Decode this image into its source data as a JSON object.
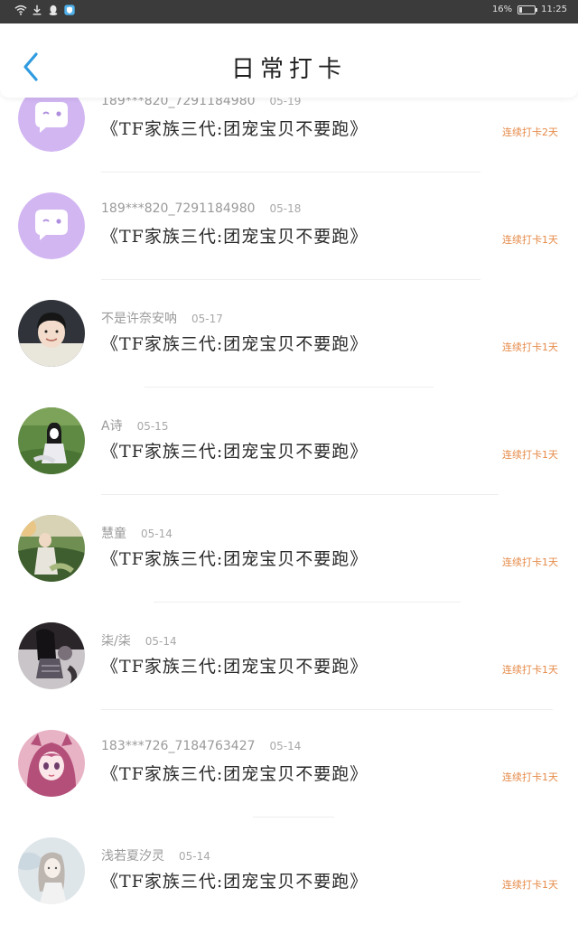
{
  "status_bar": {
    "battery_text": "16%",
    "battery_level_percent": 16,
    "time": "11:25"
  },
  "header": {
    "back_icon": "chevron-left-icon",
    "title": "日常打卡"
  },
  "colors": {
    "accent_blue": "#2f9be0",
    "streak_orange": "#e58a48",
    "chat_avatar_purple": "#d2b6f2"
  },
  "checkins": [
    {
      "user": "189***820_7291184980",
      "date": "05-19",
      "title": "《TF家族三代:团宠宝贝不要跑》",
      "streak": "连续打卡2天",
      "avatar": "chat-bubble-avatar"
    },
    {
      "user": "189***820_7291184980",
      "date": "05-18",
      "title": "《TF家族三代:团宠宝贝不要跑》",
      "streak": "连续打卡1天",
      "avatar": "chat-bubble-avatar"
    },
    {
      "user": "不是许奈安呐",
      "date": "05-17",
      "title": "《TF家族三代:团宠宝贝不要跑》",
      "streak": "连续打卡1天",
      "avatar": "boy-photo-avatar"
    },
    {
      "user": "A诗",
      "date": "05-15",
      "title": "《TF家族三代:团宠宝贝不要跑》",
      "streak": "连续打卡1天",
      "avatar": "girl-on-grass-avatar"
    },
    {
      "user": "慧童",
      "date": "05-14",
      "title": "《TF家族三代:团宠宝贝不要跑》",
      "streak": "连续打卡1天",
      "avatar": "garden-girl-avatar"
    },
    {
      "user": "柒/柒",
      "date": "05-14",
      "title": "《TF家族三代:团宠宝贝不要跑》",
      "streak": "连续打卡1天",
      "avatar": "dark-photo-avatar"
    },
    {
      "user": "183***726_7184763427",
      "date": "05-14",
      "title": "《TF家族三代:团宠宝贝不要跑》",
      "streak": "连续打卡1天",
      "avatar": "anime-girl-avatar"
    },
    {
      "user": "浅若夏汐灵",
      "date": "05-14",
      "title": "《TF家族三代:团宠宝贝不要跑》",
      "streak": "连续打卡1天",
      "avatar": "sketch-girl-avatar"
    }
  ]
}
